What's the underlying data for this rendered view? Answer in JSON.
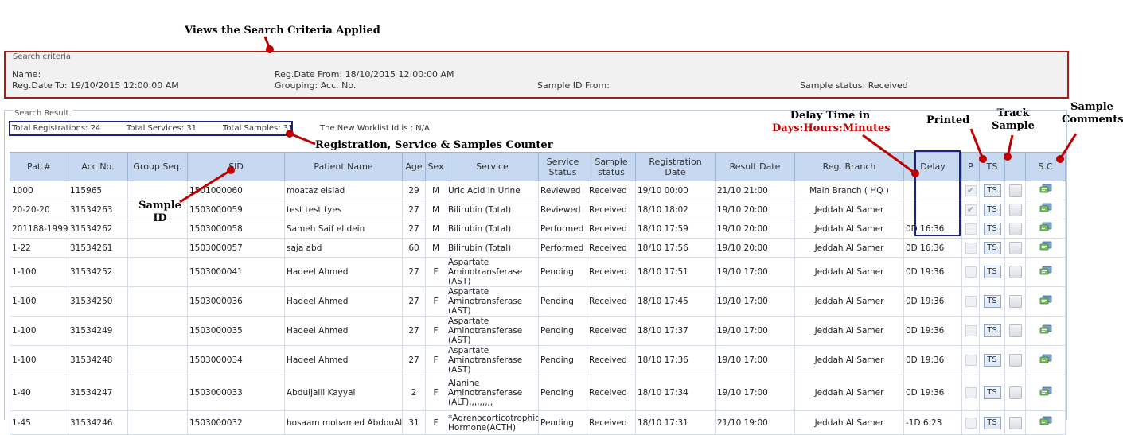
{
  "annotations": {
    "search_criteria": "Views the Search Criteria Applied",
    "counter": "Registration, Service & Samples Counter",
    "sample_id": [
      "Sample",
      "ID"
    ],
    "delay_title": "Delay Time in",
    "delay_format": "Days:Hours:Minutes",
    "printed": "Printed",
    "track_sample": [
      "Track",
      "Sample"
    ],
    "sample_comments": [
      "Sample",
      "Comments"
    ]
  },
  "criteria": {
    "legend": "Search criteria",
    "name": "Name:",
    "reg_date_from": "Reg.Date From: 18/10/2015 12:00:00 AM",
    "reg_date_to": "Reg.Date To: 19/10/2015 12:00:00 AM",
    "grouping": "Grouping: Acc. No.",
    "sample_id_from": "Sample ID From:",
    "sample_status": "Sample status: Received"
  },
  "result": {
    "legend": "Search Result.",
    "total_registrations": "Total Registrations: 24",
    "total_services": "Total Services: 31",
    "total_samples": "Total Samples: 31",
    "worklist": "The New Worklist Id is :  N/A"
  },
  "columns": [
    "Pat.#",
    "Acc No.",
    "Group Seq.",
    "SID",
    "Patient Name",
    "Age",
    "Sex",
    "Service",
    "Service Status",
    "Sample status",
    "Registration Date",
    "Result Date",
    "Reg. Branch",
    "Delay",
    "P",
    "TS",
    "",
    "S.C"
  ],
  "ts_label": "TS",
  "rows": [
    {
      "pat": "1000",
      "acc": "115965",
      "seq": "",
      "sid": "1501000060",
      "name": "moataz elsiad",
      "age": "29",
      "sex": "M",
      "service": "Uric Acid in Urine",
      "sstatus": "Reviewed",
      "sample": "Received",
      "reg": "19/10 00:00",
      "res": "21/10 21:00",
      "branch": "Main Branch ( HQ )",
      "delay": "",
      "printed": true
    },
    {
      "pat": "20-20-20",
      "acc": "31534263",
      "seq": "",
      "sid": "1503000059",
      "name": "test test tyes",
      "age": "27",
      "sex": "M",
      "service": "Bilirubin (Total)",
      "sstatus": "Reviewed",
      "sample": "Received",
      "reg": "18/10 18:02",
      "res": "19/10 20:00",
      "branch": "Jeddah Al Samer",
      "delay": "",
      "printed": true
    },
    {
      "pat": "201188-1999",
      "acc": "31534262",
      "seq": "",
      "sid": "1503000058",
      "name": "Sameh Saif el dein",
      "age": "27",
      "sex": "M",
      "service": "Bilirubin (Total)",
      "sstatus": "Performed",
      "sample": "Received",
      "reg": "18/10 17:59",
      "res": "19/10 20:00",
      "branch": "Jeddah Al Samer",
      "delay": "0D 16:36",
      "printed": false
    },
    {
      "pat": "1-22",
      "acc": "31534261",
      "seq": "",
      "sid": "1503000057",
      "name": "saja abd",
      "age": "60",
      "sex": "M",
      "service": "Bilirubin (Total)",
      "sstatus": "Performed",
      "sample": "Received",
      "reg": "18/10 17:56",
      "res": "19/10 20:00",
      "branch": "Jeddah Al Samer",
      "delay": "0D 16:36",
      "printed": false
    },
    {
      "pat": "1-100",
      "acc": "31534252",
      "seq": "",
      "sid": "1503000041",
      "name": "Hadeel Ahmed",
      "age": "27",
      "sex": "F",
      "service": "Aspartate Aminotransferase (AST)",
      "sstatus": "Pending",
      "sample": "Received",
      "reg": "18/10 17:51",
      "res": "19/10 17:00",
      "branch": "Jeddah Al Samer",
      "delay": "0D 19:36",
      "printed": false
    },
    {
      "pat": "1-100",
      "acc": "31534250",
      "seq": "",
      "sid": "1503000036",
      "name": "Hadeel Ahmed",
      "age": "27",
      "sex": "F",
      "service": "Aspartate Aminotransferase (AST)",
      "sstatus": "Pending",
      "sample": "Received",
      "reg": "18/10 17:45",
      "res": "19/10 17:00",
      "branch": "Jeddah Al Samer",
      "delay": "0D 19:36",
      "printed": false
    },
    {
      "pat": "1-100",
      "acc": "31534249",
      "seq": "",
      "sid": "1503000035",
      "name": "Hadeel Ahmed",
      "age": "27",
      "sex": "F",
      "service": "Aspartate Aminotransferase (AST)",
      "sstatus": "Pending",
      "sample": "Received",
      "reg": "18/10 17:37",
      "res": "19/10 17:00",
      "branch": "Jeddah Al Samer",
      "delay": "0D 19:36",
      "printed": false
    },
    {
      "pat": "1-100",
      "acc": "31534248",
      "seq": "",
      "sid": "1503000034",
      "name": "Hadeel Ahmed",
      "age": "27",
      "sex": "F",
      "service": "Aspartate Aminotransferase (AST)",
      "sstatus": "Pending",
      "sample": "Received",
      "reg": "18/10 17:36",
      "res": "19/10 17:00",
      "branch": "Jeddah Al Samer",
      "delay": "0D 19:36",
      "printed": false
    },
    {
      "pat": "1-40",
      "acc": "31534247",
      "seq": "",
      "sid": "1503000033",
      "name": "Abduljalil Kayyal",
      "age": "2",
      "sex": "F",
      "service": "Alanine Aminotransferase (ALT),,,,,,,,,",
      "sstatus": "Pending",
      "sample": "Received",
      "reg": "18/10 17:34",
      "res": "19/10 17:00",
      "branch": "Jeddah Al Samer",
      "delay": "0D 19:36",
      "printed": false
    },
    {
      "pat": "1-45",
      "acc": "31534246",
      "seq": "",
      "sid": "1503000032",
      "name": "hosaam mohamed AbdouAlla",
      "age": "31",
      "sex": "F",
      "service": "*Adrenocorticotrophic Hormone(ACTH)",
      "sstatus": "Pending",
      "sample": "Received",
      "reg": "18/10 17:31",
      "res": "21/10 19:00",
      "branch": "Jeddah Al Samer",
      "delay": "-1D 6:23",
      "printed": false
    }
  ],
  "colors": {
    "annotation_red": "#c00000",
    "frame_red": "#a81c1c",
    "frame_navy": "#1a237e",
    "header_blue": "#c6d9f1",
    "status_green": "#1a8a1a",
    "status_red": "#dd1111"
  }
}
